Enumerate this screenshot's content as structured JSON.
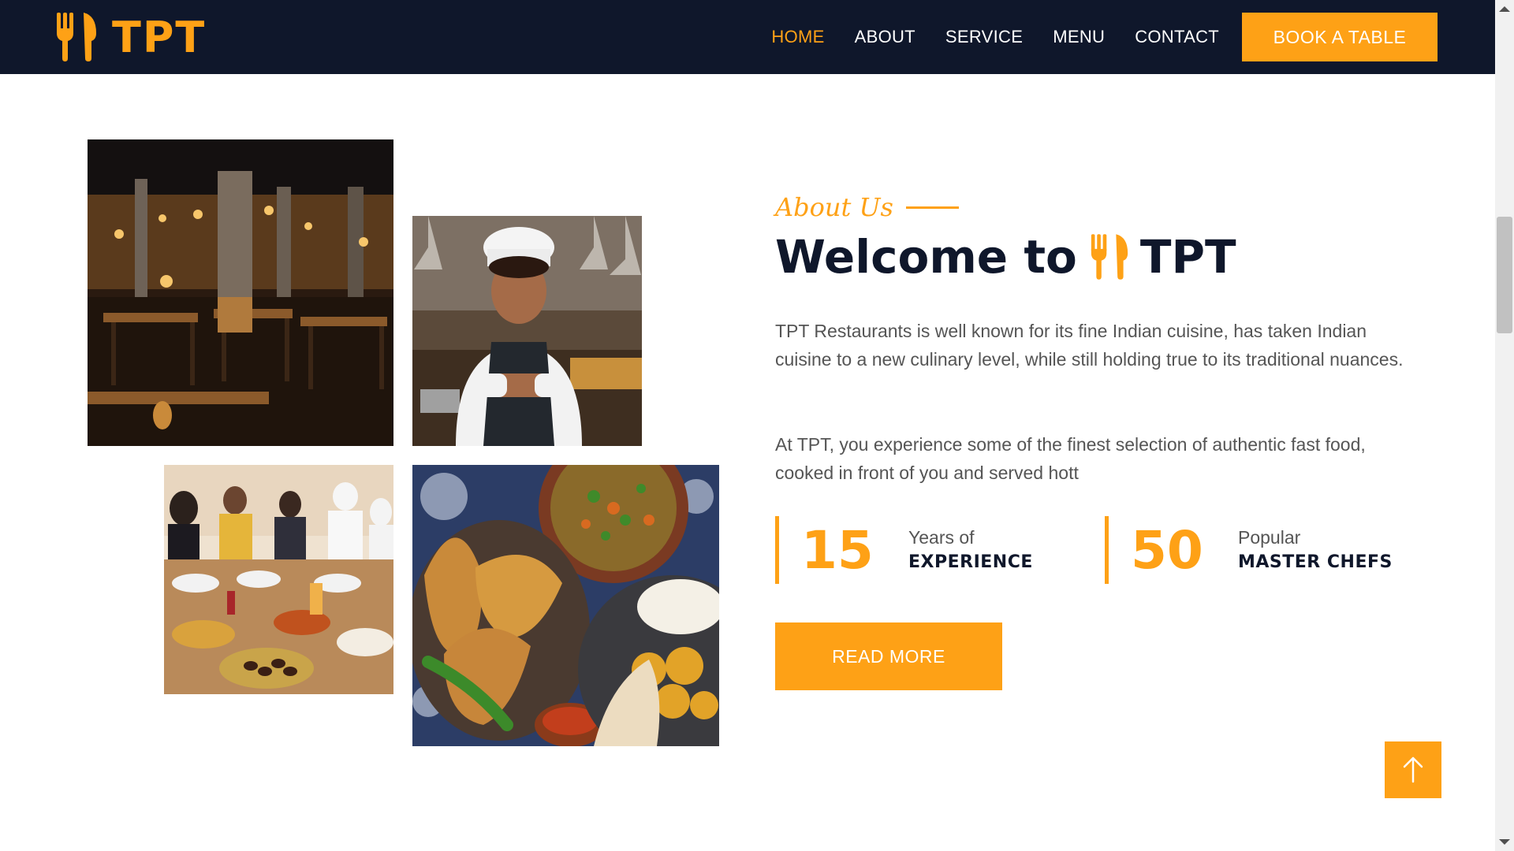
{
  "brand": {
    "name": "TPT",
    "logo_icon": "utensils-icon",
    "accent_color": "#fea116",
    "dark_color": "#0f172b"
  },
  "nav": {
    "items": [
      {
        "label": "HOME",
        "active": true
      },
      {
        "label": "ABOUT",
        "active": false
      },
      {
        "label": "SERVICE",
        "active": false
      },
      {
        "label": "MENU",
        "active": false
      },
      {
        "label": "CONTACT",
        "active": false
      }
    ],
    "cta": "BOOK A TABLE"
  },
  "about": {
    "tag": "About Us",
    "headline_prefix": "Welcome to",
    "headline_brand": "TPT",
    "paragraph1": "TPT Restaurants is well known for its fine Indian cuisine, has taken Indian cuisine to a new culinary level, while still holding true to its traditional nuances.",
    "paragraph2": "At TPT, you experience some of the finest selection of authentic fast food, cooked in front of you and served hott",
    "stats": [
      {
        "number": "15",
        "label_top": "Years of",
        "label_bottom": "EXPERIENCE"
      },
      {
        "number": "50",
        "label_top": "Popular",
        "label_bottom": "MASTER CHEFS"
      }
    ],
    "button": "READ MORE"
  },
  "back_to_top_icon": "arrow-up-icon"
}
